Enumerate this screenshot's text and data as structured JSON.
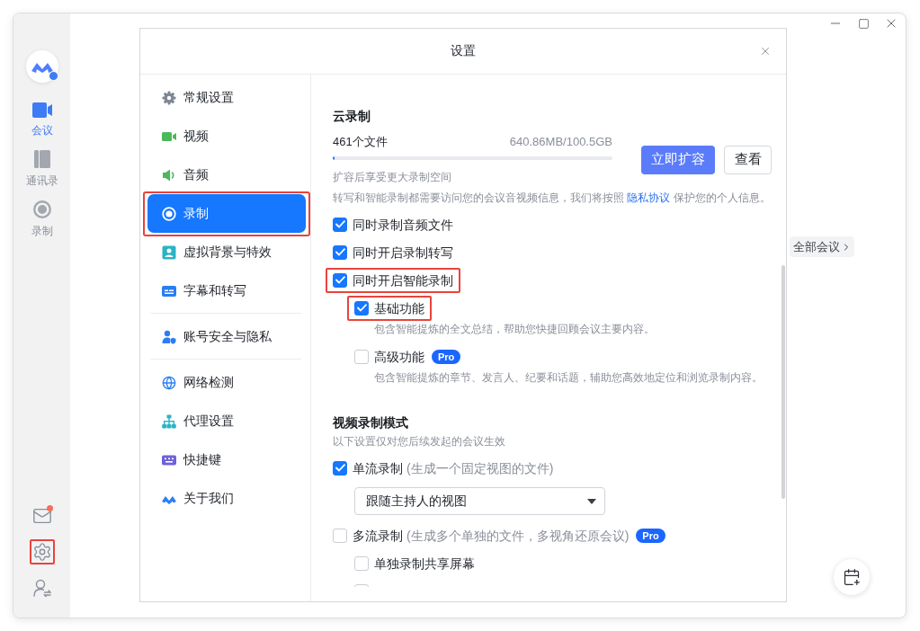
{
  "window": {
    "rail": {
      "items": [
        {
          "label": "会议",
          "selected": true
        },
        {
          "label": "通讯录",
          "selected": false
        },
        {
          "label": "录制",
          "selected": false
        }
      ],
      "tools": [
        {
          "unread": true,
          "annotated": false
        },
        {
          "unread": false,
          "annotated": true
        },
        {
          "unread": false,
          "annotated": false
        }
      ]
    },
    "main": {
      "all_meetings": "全部会议"
    }
  },
  "dialog": {
    "title": "设置",
    "nav": {
      "groups": [
        {
          "items": [
            {
              "label": "常规设置",
              "selected": false,
              "annotated": false
            },
            {
              "label": "视频",
              "selected": false,
              "annotated": false
            },
            {
              "label": "音频",
              "selected": false,
              "annotated": false
            },
            {
              "label": "录制",
              "selected": true,
              "annotated": true
            },
            {
              "label": "虚拟背景与特效",
              "selected": false,
              "annotated": false
            },
            {
              "label": "字幕和转写",
              "selected": false,
              "annotated": false
            }
          ]
        },
        {
          "items": [
            {
              "label": "账号安全与隐私",
              "selected": false,
              "annotated": false
            }
          ]
        },
        {
          "items": [
            {
              "label": "网络检测",
              "selected": false,
              "annotated": false
            },
            {
              "label": "代理设置",
              "selected": false,
              "annotated": false
            },
            {
              "label": "快捷键",
              "selected": false,
              "annotated": false
            },
            {
              "label": "关于我们",
              "selected": false,
              "annotated": false
            }
          ]
        }
      ]
    },
    "cloud_recording": {
      "heading": "云录制",
      "file_count": "461个文件",
      "usage": "640.86MB/100.5GB",
      "level": 0.006,
      "hint": "扩容后享受更大录制空间",
      "expand_button": "立即扩容",
      "view_button": "查看",
      "privacy_note": {
        "before": "转写和智能录制都需要访问您的会议音视频信息，我们将按照 ",
        "link": "隐私协议",
        "after": " 保护您的个人信息。"
      },
      "options": [
        {
          "label": "同时录制音频文件",
          "checked": true,
          "annotated": false
        },
        {
          "label": "同时开启录制转写",
          "checked": true,
          "annotated": false
        },
        {
          "label": "同时开启智能录制",
          "checked": true,
          "annotated": true,
          "children": [
            {
              "label": "基础功能",
              "checked": true,
              "annotated": true,
              "description": "包含智能提炼的全文总结，帮助您快捷回顾会议主要内容。"
            },
            {
              "label": "高级功能",
              "checked": false,
              "annotated": false,
              "badge": "Pro",
              "description": "包含智能提炼的章节、发言人、纪要和话题，辅助您高效地定位和浏览录制内容。"
            }
          ]
        }
      ]
    },
    "video_mode": {
      "heading": "视频录制模式",
      "note": "以下设置仅对您后续发起的会议生效",
      "options": [
        {
          "label": "单流录制",
          "detail": "(生成一个固定视图的文件)",
          "checked": true,
          "select": {
            "value": "跟随主持人的视图"
          }
        },
        {
          "label": "多流录制",
          "detail": "(生成多个单独的文件，多视角还原会议)",
          "checked": false,
          "badge": "Pro",
          "children": [
            {
              "label": "单独录制共享屏幕",
              "checked": false
            },
            {
              "checked": false
            }
          ]
        }
      ]
    }
  }
}
